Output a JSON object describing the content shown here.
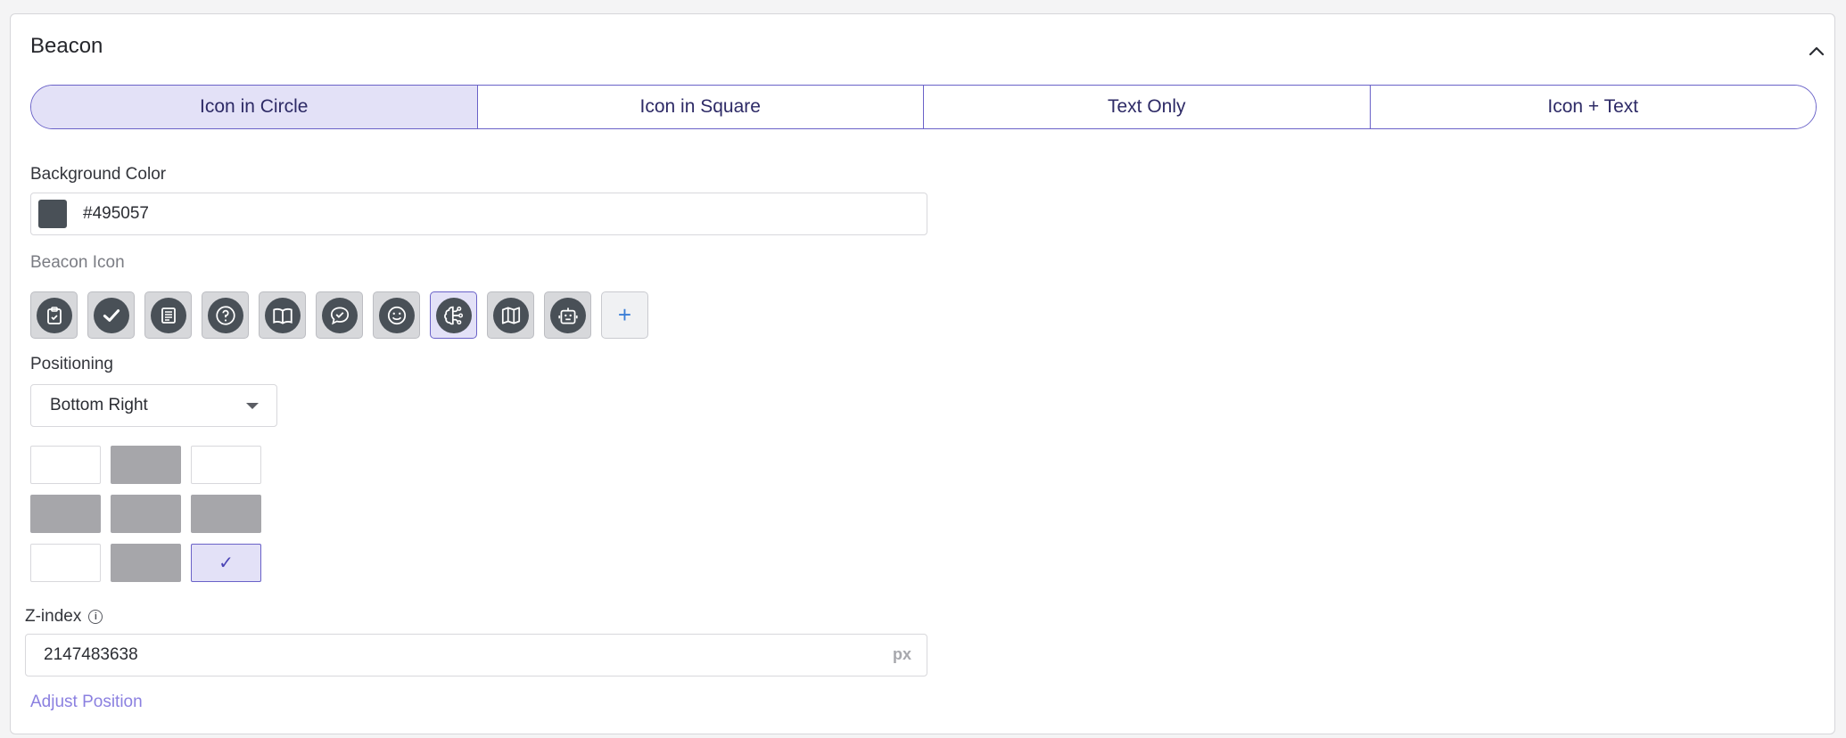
{
  "panel": {
    "title": "Beacon"
  },
  "style_tabs": [
    {
      "label": "Icon in Circle",
      "active": true
    },
    {
      "label": "Icon in Square",
      "active": false
    },
    {
      "label": "Text Only",
      "active": false
    },
    {
      "label": "Icon + Text",
      "active": false
    }
  ],
  "background": {
    "label": "Background Color",
    "value": "#495057",
    "swatch": "#495057"
  },
  "beacon_icon": {
    "label": "Beacon Icon",
    "icons": [
      "clipboard-check-icon",
      "checkmark-icon",
      "document-icon",
      "question-icon",
      "book-open-icon",
      "chat-check-icon",
      "smiley-icon",
      "brain-network-icon",
      "map-icon",
      "robot-icon"
    ],
    "selected": "brain-network-icon",
    "add_label": "+"
  },
  "positioning": {
    "label": "Positioning",
    "value": "Bottom Right",
    "grid": [
      [
        "empty",
        "filled",
        "empty"
      ],
      [
        "filled",
        "filled",
        "filled"
      ],
      [
        "empty",
        "filled",
        "selected"
      ]
    ],
    "check": "✓"
  },
  "zindex": {
    "label": "Z-index",
    "value": "2147483638",
    "unit": "px"
  },
  "adjust_link": "Adjust Position",
  "colors": {
    "accent": "#6a62c8",
    "accent_bg": "#e3e1f7",
    "icon_bg": "#495057",
    "link": "#8b80e0"
  }
}
